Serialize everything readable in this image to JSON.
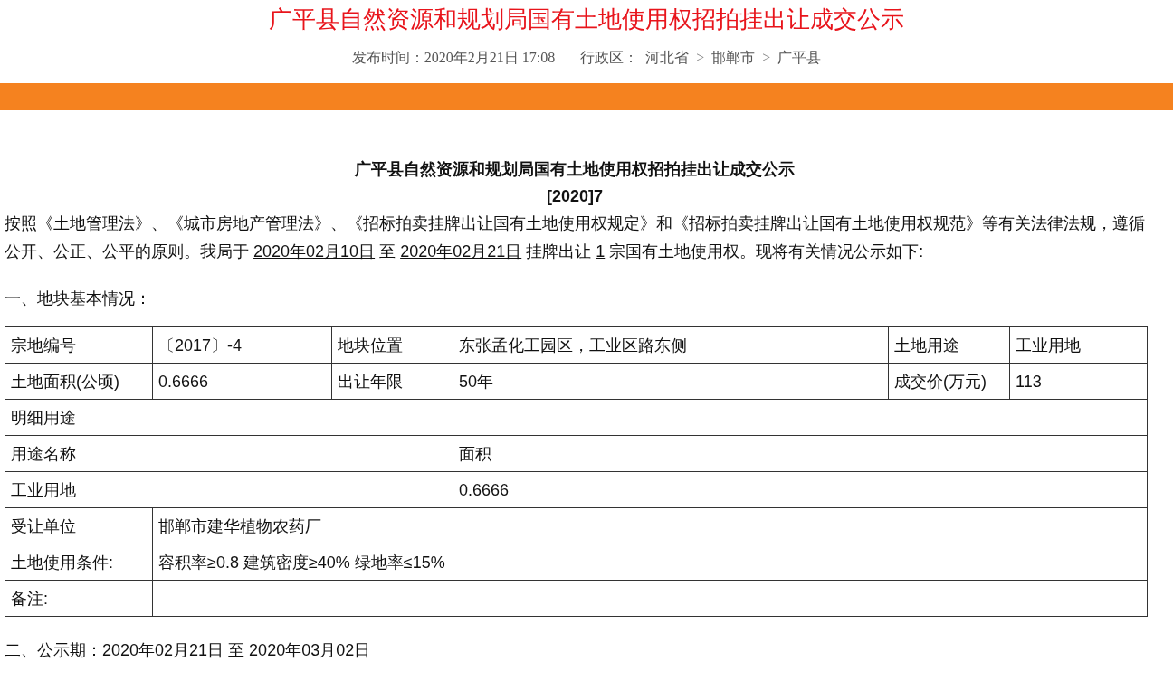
{
  "header": {
    "title": "广平县自然资源和规划局国有土地使用权招拍挂出让成交公示",
    "published": "发布时间：2020年2月21日  17:08",
    "region_label": "行政区：",
    "region_separator": ">",
    "region": [
      "河北省",
      "邯郸市",
      "广平县"
    ]
  },
  "notice": {
    "title": "广平县自然资源和规划局国有土地使用权招拍挂出让成交公示",
    "number": "[2020]7",
    "paragraph": [
      {
        "text": "按照《土地管理法》、《城市房地产管理法》、《招标拍卖挂牌出让国有土地使用权规定》和《招标拍卖挂牌出让国有土地使用权规范》等有关法律法规，遵循公开、公正、公平的原则。我局于 ",
        "underline": false
      },
      {
        "text": "2020年02月10日",
        "underline": true
      },
      {
        "text": " 至 ",
        "underline": false
      },
      {
        "text": "2020年02月21日",
        "underline": true
      },
      {
        "text": " 挂牌出让 ",
        "underline": false
      },
      {
        "text": "1",
        "underline": true
      },
      {
        "text": " 宗国有土地使用权。现将有关情况公示如下:",
        "underline": false
      }
    ],
    "section_1": "一、地块基本情况：",
    "table": [
      {
        "kind": "grid",
        "cells": [
          "宗地编号",
          "〔2017〕-4",
          "地块位置",
          "东张孟化工园区，工业区路东侧",
          "土地用途",
          "工业用地"
        ]
      },
      {
        "kind": "grid",
        "cells": [
          "土地面积(公顷)",
          "0.6666",
          "出让年限",
          "50年",
          "成交价(万元)",
          "113"
        ]
      },
      {
        "kind": "section",
        "cells": [
          "明细用途"
        ]
      },
      {
        "kind": "split",
        "cells": [
          "用途名称",
          "面积"
        ]
      },
      {
        "kind": "split",
        "cells": [
          "工业用地",
          "0.6666"
        ]
      },
      {
        "kind": "labeled",
        "cells": [
          "受让单位",
          "邯郸市建华植物农药厂"
        ]
      },
      {
        "kind": "labeled",
        "cells": [
          "土地使用条件:",
          "容积率≥0.8 建筑密度≥40% 绿地率≤15%"
        ]
      },
      {
        "kind": "labeled",
        "cells": [
          "备注:",
          ""
        ]
      }
    ],
    "section_2": [
      {
        "text": "二、公示期：",
        "underline": false
      },
      {
        "text": "2020年02月21日",
        "underline": true
      },
      {
        "text": " 至 ",
        "underline": false
      },
      {
        "text": "2020年03月02日",
        "underline": true
      }
    ]
  }
}
